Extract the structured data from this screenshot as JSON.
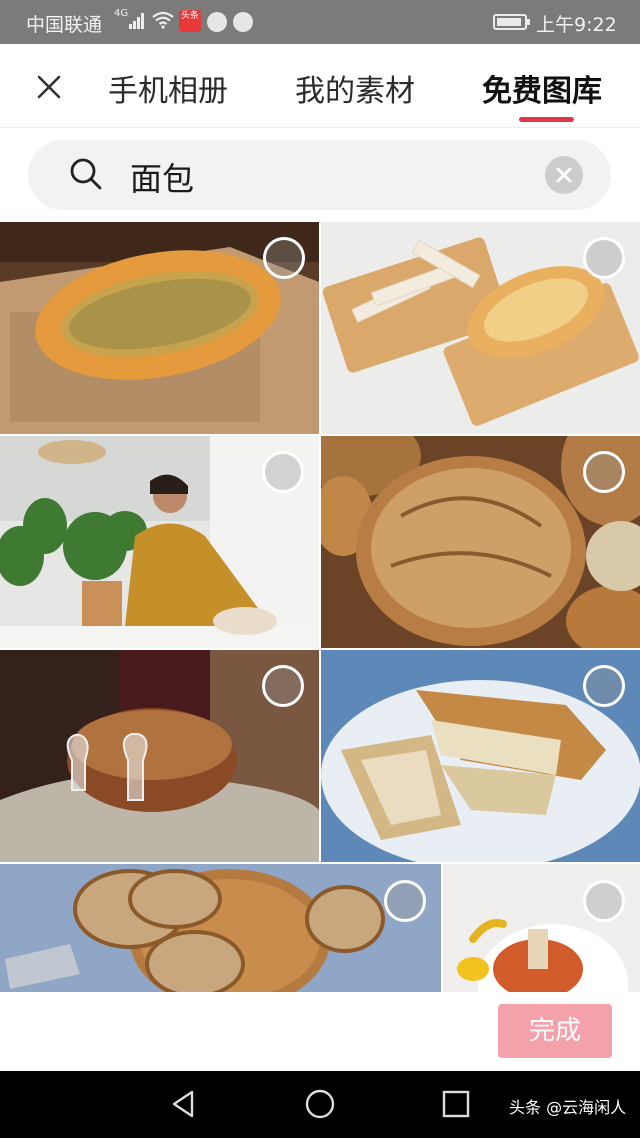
{
  "status_bar": {
    "carrier": "中国联通",
    "network": "4G",
    "app_badge": "头条",
    "time": "上午9:22"
  },
  "header": {
    "close_icon": "close-icon",
    "tabs": [
      {
        "label": "手机相册",
        "active": false
      },
      {
        "label": "我的素材",
        "active": false
      },
      {
        "label": "免费图库",
        "active": true
      }
    ],
    "accent_color": "#e1374a"
  },
  "search": {
    "query": "面包",
    "search_icon": "search-icon",
    "clear_icon": "clear-icon"
  },
  "photos": [
    {
      "subject": "garlic bread on wooden board",
      "selected": false
    },
    {
      "subject": "bread on wooden cutting boards",
      "selected": false
    },
    {
      "subject": "man baking in kitchen",
      "selected": false
    },
    {
      "subject": "round rustic loaves",
      "selected": false
    },
    {
      "subject": "cake with wine glasses",
      "selected": false
    },
    {
      "subject": "ciabatta on plate",
      "selected": false
    },
    {
      "subject": "sliced sourdough bread",
      "selected": false
    },
    {
      "subject": "sandwich with peppers",
      "selected": false
    }
  ],
  "footer": {
    "done_label": "完成",
    "done_color": "#f3a2aa"
  },
  "nav_bar": {
    "watermark": "头条 @云海闲人"
  }
}
